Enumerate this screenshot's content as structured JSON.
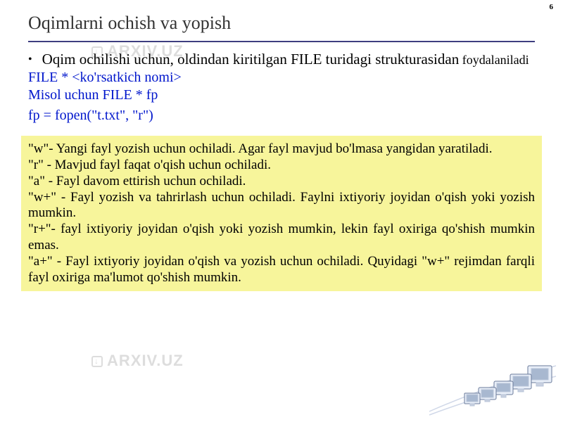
{
  "page_number": "6",
  "watermark_text": "ARXIV.UZ",
  "title": "Oqimlarni ochish va yopish",
  "bullet": {
    "main": "Oqim ochilishi uchun, oldindan kiritilgan FILE turidagi strukturasidan",
    "tail": " foydalaniladi"
  },
  "code": {
    "line1": "FILE * <ko'rsatkich nomi>",
    "line2": "Misol uchun FILE * fp",
    "line3": "fp = fopen(\"t.txt\", \"r\")"
  },
  "modes": {
    "w": "\"w\"- Yangi fayl yozish uchun ochiladi. Agar fayl mavjud bo'lmasa yangidan yaratiladi.",
    "r": "\"r\" - Mavjud fayl faqat o'qish uchun ochiladi.",
    "a": "\"a\" - Fayl davom ettirish uchun ochiladi.",
    "wplus": "\"w+\" - Fayl yozish va tahrirlash uchun ochiladi. Faylni ixtiyoriy joyidan o'qish yoki yozish mumkin.",
    "rplus": "\"r+\"- fayl ixtiyoriy joyidan o'qish yoki yozish mumkin, lekin fayl oxiriga qo'shish mumkin emas.",
    "aplus": "\"a+\" - Fayl ixtiyoriy joyidan o'qish va yozish uchun ochiladi. Quyidagi \"w+\" rejimdan farqli fayl oxiriga ma'lumot qo'shish mumkin."
  }
}
